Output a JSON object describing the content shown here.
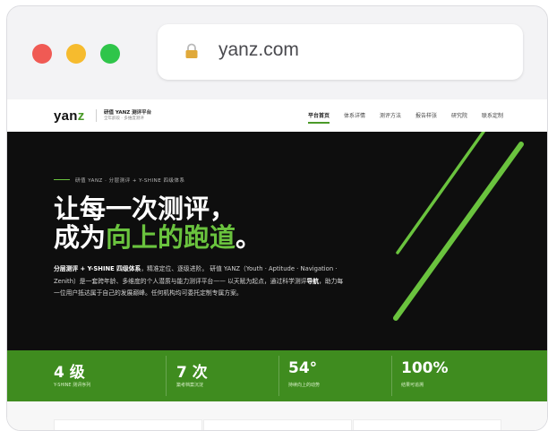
{
  "browser": {
    "url": "yanz.com"
  },
  "nav": {
    "logo_main": "yan",
    "logo_accent": "z",
    "brand_name": "研值 YANZ 测评平台",
    "brand_sub": "全年龄段 · 多维度测评",
    "items": [
      "平台首页",
      "体系详情",
      "测评方法",
      "报告样张",
      "研究院",
      "联系定制"
    ]
  },
  "hero": {
    "eyebrow": "研值 YANZ · 分层测评 + Y-SHINE 四级体系",
    "headline_line1": "让每一次测评，",
    "headline_prefix": "成为",
    "headline_highlight": "向上的跑道",
    "headline_suffix": "。",
    "desc_bold1": "分层测评 + Y-SHINE 四级体系",
    "desc_part1": "，精准定位、逐级进阶。 研值 YANZ（Youth · Aptitude · Navigation · Zenith）是一套跨年龄、多维度的个人潜质与能力测评平台—— 以天赋为起点，通过科学测评",
    "desc_bold2": "导航",
    "desc_part2": "，助力每一位用户抵达属于自己的发展巅峰。任何机构均可委托定制专属方案。"
  },
  "stats": [
    {
      "value": "4 级",
      "label": "Y-SHINE 测评序列"
    },
    {
      "value": "7 次",
      "label": "築考档案沉淀"
    },
    {
      "value": "54°",
      "label": "持续向上的动势"
    },
    {
      "value": "100%",
      "label": "结果可追溯"
    }
  ],
  "colors": {
    "accent": "#6ac33e",
    "stats_bg": "#3f8c1f",
    "hero_bg": "#0e0e0e"
  }
}
